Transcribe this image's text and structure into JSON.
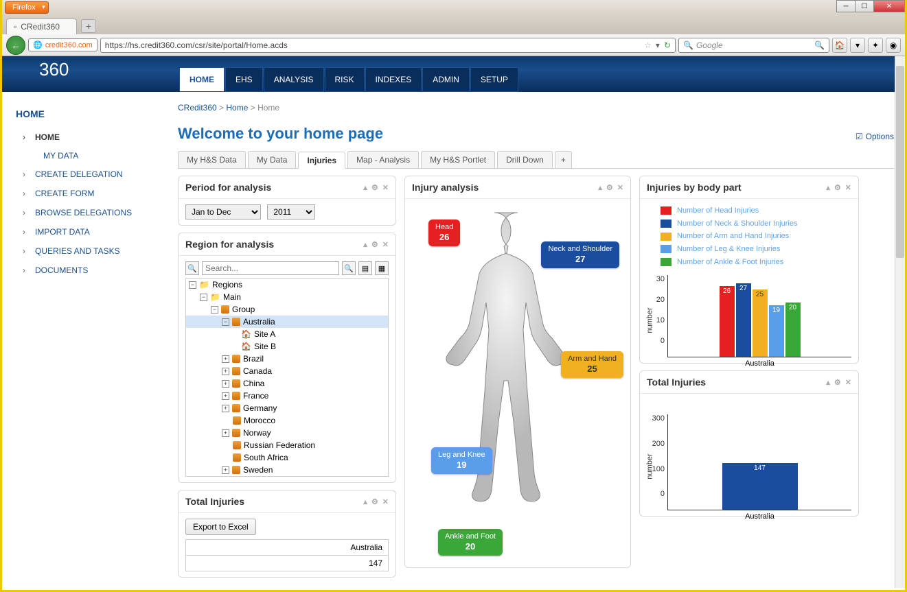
{
  "browser": {
    "name": "Firefox",
    "tab_title": "CRedit360",
    "identity": "credit360.com",
    "url": "https://hs.credit360.com/csr/site/portal/Home.acds",
    "search_placeholder": "Google"
  },
  "logo": "360",
  "topnav": [
    "HOME",
    "EHS",
    "ANALYSIS",
    "RISK",
    "INDEXES",
    "ADMIN",
    "SETUP"
  ],
  "breadcrumb": {
    "root": "CRedit360",
    "mid": "Home",
    "leaf": "Home"
  },
  "welcome": "Welcome to your home page",
  "options": "Options",
  "sidebar": {
    "title": "HOME",
    "items": [
      {
        "label": "HOME",
        "sub": "MY DATA"
      },
      {
        "label": "CREATE DELEGATION"
      },
      {
        "label": "CREATE FORM"
      },
      {
        "label": "BROWSE DELEGATIONS"
      },
      {
        "label": "IMPORT DATA"
      },
      {
        "label": "QUERIES AND TASKS"
      },
      {
        "label": "DOCUMENTS"
      }
    ]
  },
  "tabs": [
    "My H&S Data",
    "My Data",
    "Injuries",
    "Map - Analysis",
    "My H&S Portlet",
    "Drill Down"
  ],
  "tabs_active": 2,
  "period": {
    "title": "Period for analysis",
    "range": "Jan to Dec",
    "year": "2011"
  },
  "region": {
    "title": "Region for analysis",
    "search_placeholder": "Search...",
    "tree": {
      "root": "Regions",
      "main": "Main",
      "group": "Group",
      "selected": "Australia",
      "sites": [
        "Site A",
        "Site B"
      ],
      "countries": [
        "Brazil",
        "Canada",
        "China",
        "France",
        "Germany",
        "Morocco",
        "Norway",
        "Russian Federation",
        "South Africa",
        "Sweden"
      ]
    }
  },
  "total_injuries_export": {
    "title": "Total Injuries",
    "button": "Export to Excel",
    "row_label": "Australia",
    "row_value": "147"
  },
  "injury_analysis": {
    "title": "Injury analysis",
    "labels": {
      "head": {
        "text": "Head",
        "value": "26"
      },
      "neck": {
        "text": "Neck and Shoulder",
        "value": "27"
      },
      "arm": {
        "text": "Arm and Hand",
        "value": "25"
      },
      "leg": {
        "text": "Leg and Knee",
        "value": "19"
      },
      "ankle": {
        "text": "Ankle and Foot",
        "value": "20"
      }
    }
  },
  "injuries_by_part": {
    "title": "Injuries by body part",
    "legend": [
      {
        "label": "Number of Head Injuries",
        "color": "#e62020"
      },
      {
        "label": "Number of Neck & Shoulder Injuries",
        "color": "#1a4d9e"
      },
      {
        "label": "Number of Arm and Hand Injuries",
        "color": "#f0b020"
      },
      {
        "label": "Number of Leg & Knee Injuries",
        "color": "#5a9de8"
      },
      {
        "label": "Number of Ankle & Foot Injuries",
        "color": "#3aa838"
      }
    ],
    "x_label": "Australia",
    "y_label": "number"
  },
  "total_injuries_chart": {
    "title": "Total Injuries",
    "x_label": "Australia",
    "y_label": "number",
    "value": "147"
  },
  "chart_data": [
    {
      "type": "bar",
      "title": "Injuries by body part",
      "categories": [
        "Australia"
      ],
      "series": [
        {
          "name": "Number of Head Injuries",
          "values": [
            26
          ],
          "color": "#e62020"
        },
        {
          "name": "Number of Neck & Shoulder Injuries",
          "values": [
            27
          ],
          "color": "#1a4d9e"
        },
        {
          "name": "Number of Arm and Hand Injuries",
          "values": [
            25
          ],
          "color": "#f0b020"
        },
        {
          "name": "Number of Leg & Knee Injuries",
          "values": [
            19
          ],
          "color": "#5a9de8"
        },
        {
          "name": "Number of Ankle & Foot Injuries",
          "values": [
            20
          ],
          "color": "#3aa838"
        }
      ],
      "ylabel": "number",
      "ylim": [
        0,
        30
      ],
      "yticks": [
        0,
        10,
        20,
        30
      ]
    },
    {
      "type": "bar",
      "title": "Total Injuries",
      "categories": [
        "Australia"
      ],
      "values": [
        147
      ],
      "ylabel": "number",
      "ylim": [
        0,
        300
      ],
      "yticks": [
        0,
        100,
        200,
        300
      ]
    }
  ]
}
